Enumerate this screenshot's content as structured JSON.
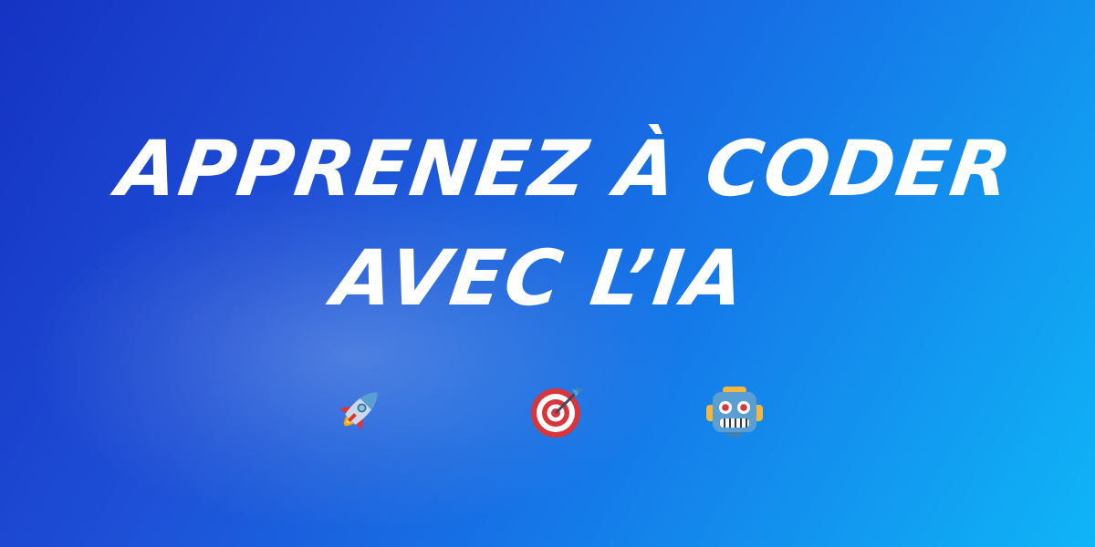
{
  "headline": {
    "line1": "APPRENEZ À CODER",
    "line2": "AVEC L’IA",
    "color": "#ffffff"
  },
  "background": {
    "gradient_start": "#1533c4",
    "gradient_end": "#0fb5f7"
  },
  "icons": [
    "rocket-icon",
    "target-dart-icon",
    "robot-icon"
  ]
}
